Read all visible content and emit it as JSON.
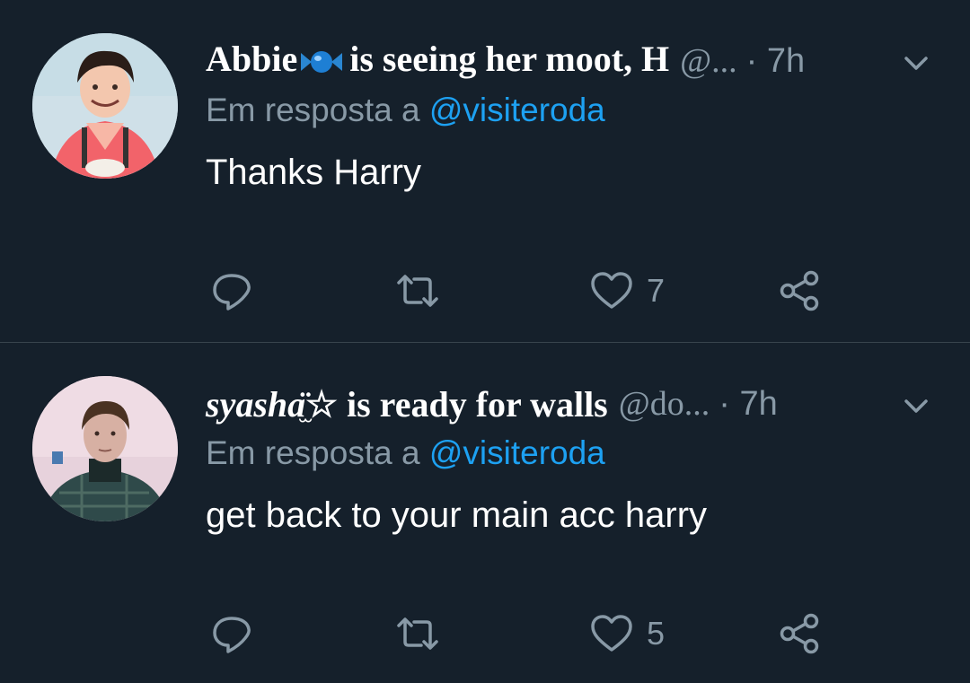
{
  "colors": {
    "background": "#15202b",
    "primary_text": "#ffffff",
    "secondary_text": "#8899a6",
    "link": "#1da1f2",
    "divider": "#38444d"
  },
  "tweets": [
    {
      "display_name_start": "Abbie",
      "name_emoji": "candy-emoji",
      "display_name_rest": "is seeing her moot, H",
      "handle": "@...",
      "time": "· 7h",
      "reply_prefix": "Em resposta a",
      "reply_to": "@visiteroda",
      "text": "Thanks Harry",
      "avatar": "avatar-photo",
      "actions": {
        "reply_icon": "reply-icon",
        "retweet_icon": "retweet-icon",
        "like_icon": "heart-icon",
        "like_count": "7",
        "share_icon": "share-icon"
      }
    },
    {
      "display_name_start": "syasha",
      "name_kaomoji": "̫̈",
      "display_name_rest": "☆ is ready for walls",
      "handle": "@do...",
      "time": "· 7h",
      "reply_prefix": "Em resposta a",
      "reply_to": "@visiteroda",
      "text": "get back to your main acc harry",
      "avatar": "avatar-photo",
      "actions": {
        "reply_icon": "reply-icon",
        "retweet_icon": "retweet-icon",
        "like_icon": "heart-icon",
        "like_count": "5",
        "share_icon": "share-icon"
      }
    }
  ]
}
